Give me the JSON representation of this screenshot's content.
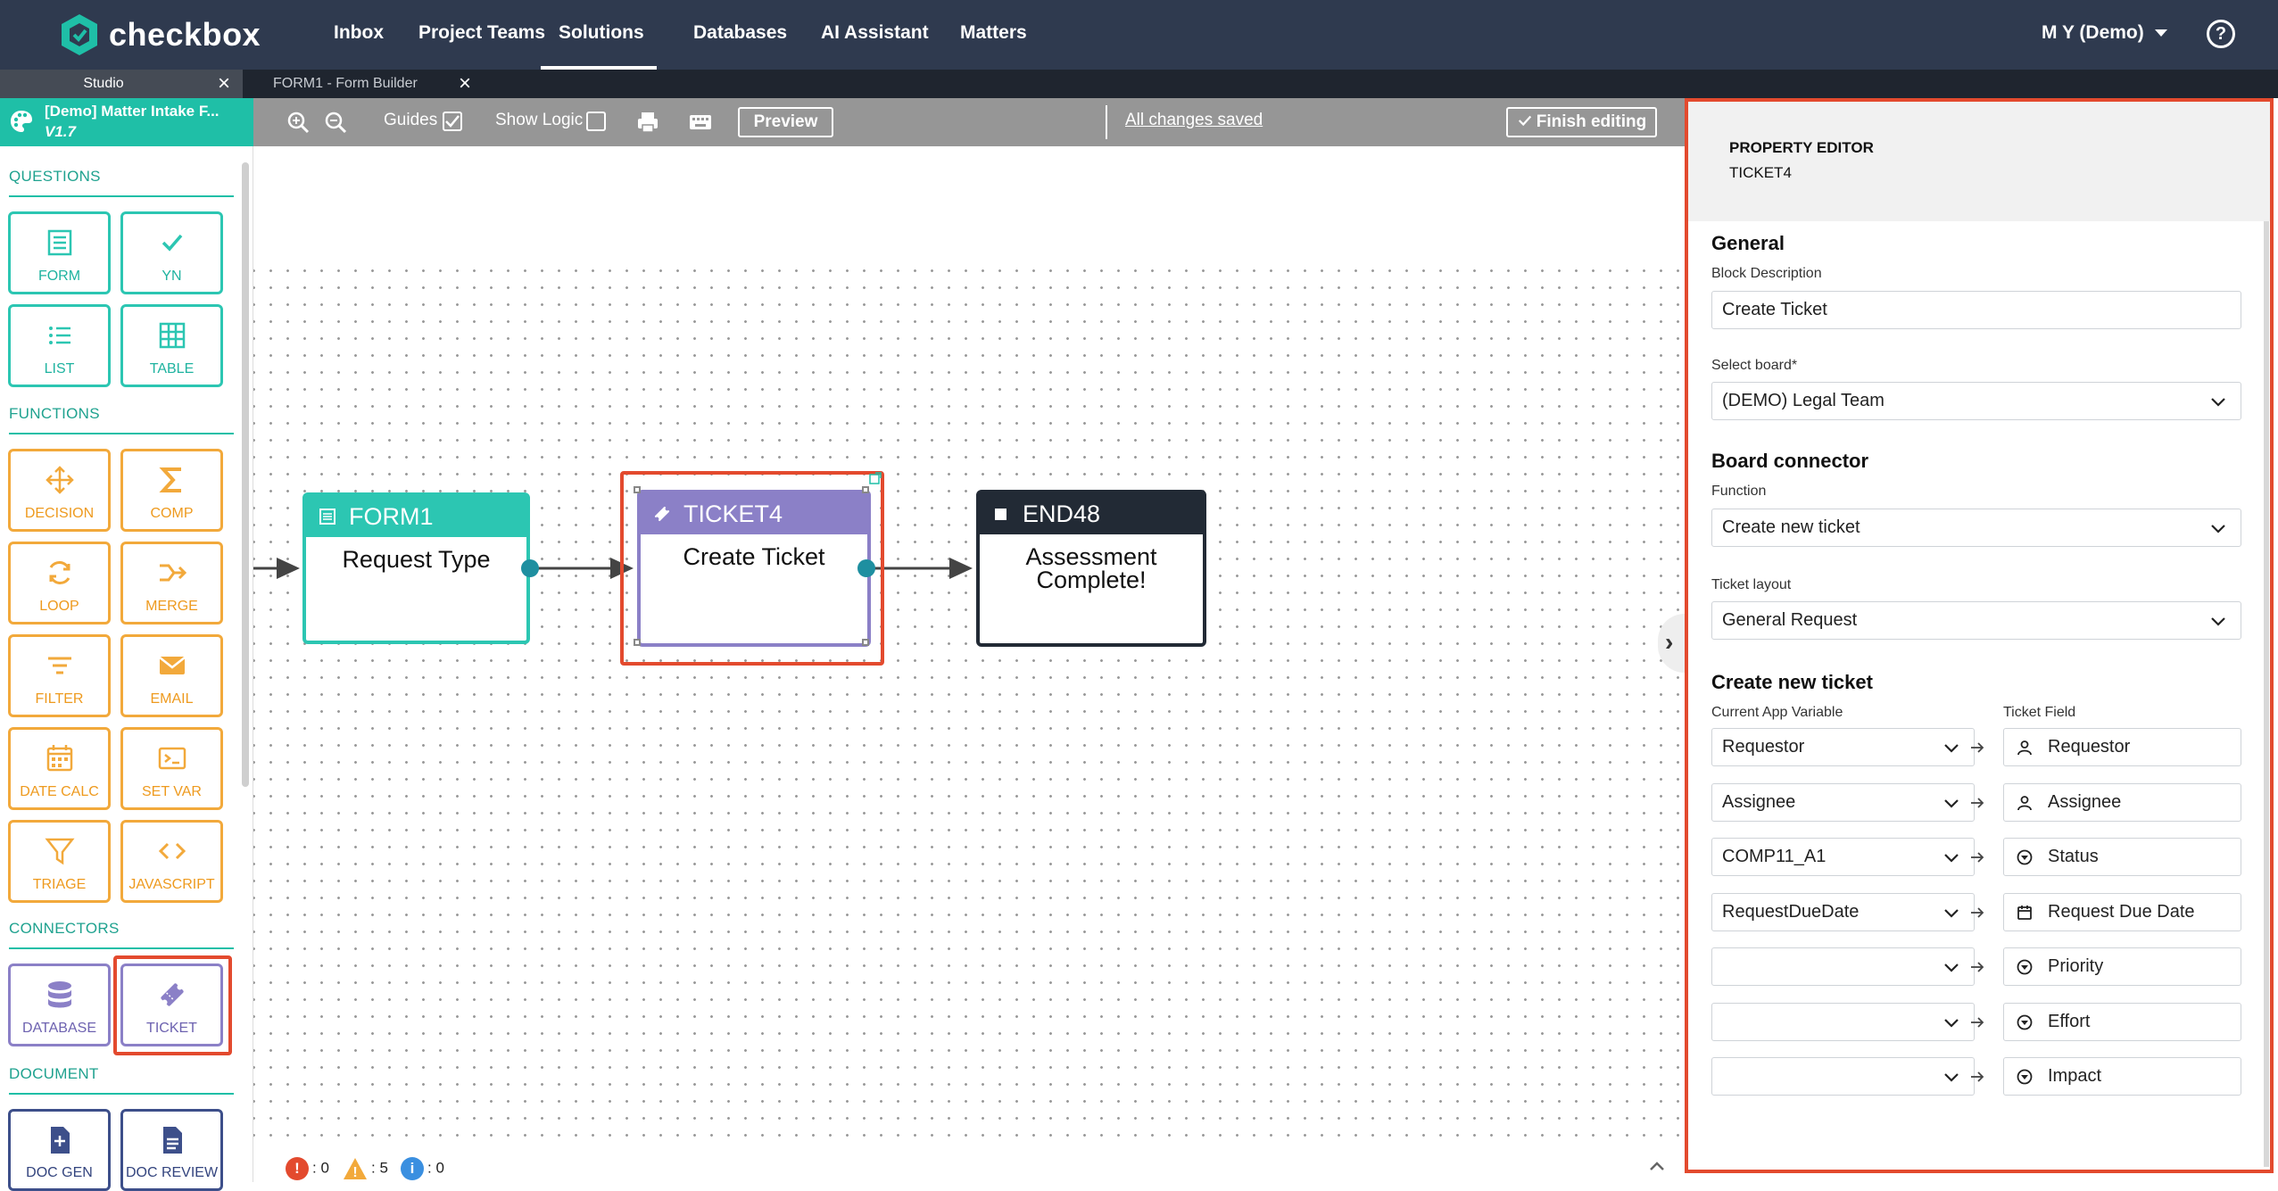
{
  "nav": {
    "brand": "checkbox",
    "items": [
      "Inbox",
      "Project Teams",
      "Solutions",
      "Databases",
      "AI Assistant",
      "Matters"
    ],
    "active_index": 2,
    "user": "M Y (Demo)"
  },
  "tabs": [
    {
      "label": "Studio"
    },
    {
      "label": "FORM1 - Form Builder"
    }
  ],
  "sidebar": {
    "app_name": "[Demo] Matter Intake F...",
    "version": "V1.7",
    "sections": {
      "questions": "QUESTIONS",
      "functions": "FUNCTIONS",
      "connectors": "CONNECTORS",
      "document": "DOCUMENT"
    },
    "questions": [
      "FORM",
      "YN",
      "LIST",
      "TABLE"
    ],
    "functions": [
      "DECISION",
      "COMP",
      "LOOP",
      "MERGE",
      "FILTER",
      "EMAIL",
      "DATE CALC",
      "SET VAR",
      "TRIAGE",
      "JAVASCRIPT"
    ],
    "connectors": [
      "DATABASE",
      "TICKET"
    ],
    "document": [
      "DOC GEN",
      "DOC REVIEW"
    ]
  },
  "toolbar": {
    "guides": "Guides",
    "guides_checked": true,
    "show_logic": "Show Logic",
    "show_logic_checked": false,
    "preview": "Preview",
    "saved": "All changes saved",
    "finish": "Finish editing"
  },
  "flow": {
    "nodes": [
      {
        "id": "FORM1",
        "body": "Request Type"
      },
      {
        "id": "TICKET4",
        "body": "Create Ticket"
      },
      {
        "id": "END48",
        "body": "Assessment Complete!"
      }
    ]
  },
  "status": {
    "errors": "0",
    "warnings": "5",
    "info": "0"
  },
  "property_editor": {
    "heading": "PROPERTY EDITOR",
    "block_id": "TICKET4",
    "general": "General",
    "block_description_label": "Block Description",
    "block_description": "Create Ticket",
    "select_board_label": "Select board*",
    "select_board": "(DEMO) Legal Team",
    "board_connector": "Board connector",
    "function_label": "Function",
    "function": "Create new ticket",
    "ticket_layout_label": "Ticket layout",
    "ticket_layout": "General Request",
    "create_new_ticket": "Create new ticket",
    "col_left": "Current App Variable",
    "col_right": "Ticket Field",
    "mappings": [
      {
        "variable": "Requestor",
        "field": "Requestor",
        "icon": "person-icon"
      },
      {
        "variable": "Assignee",
        "field": "Assignee",
        "icon": "person-icon"
      },
      {
        "variable": "COMP11_A1",
        "field": "Status",
        "icon": "dropdown-circle-icon"
      },
      {
        "variable": "RequestDueDate",
        "field": "Request Due Date",
        "icon": "calendar-icon"
      },
      {
        "variable": "",
        "field": "Priority",
        "icon": "dropdown-circle-icon"
      },
      {
        "variable": "",
        "field": "Effort",
        "icon": "dropdown-circle-icon"
      },
      {
        "variable": "",
        "field": "Impact",
        "icon": "dropdown-circle-icon"
      }
    ]
  },
  "colors": {
    "nav_bg": "#2f3a4f",
    "teal": "#2cc6b2",
    "orange": "#f2a93b",
    "purple": "#8b80c7",
    "dark_blue": "#3d4f8a",
    "highlight": "#e34a2e"
  }
}
